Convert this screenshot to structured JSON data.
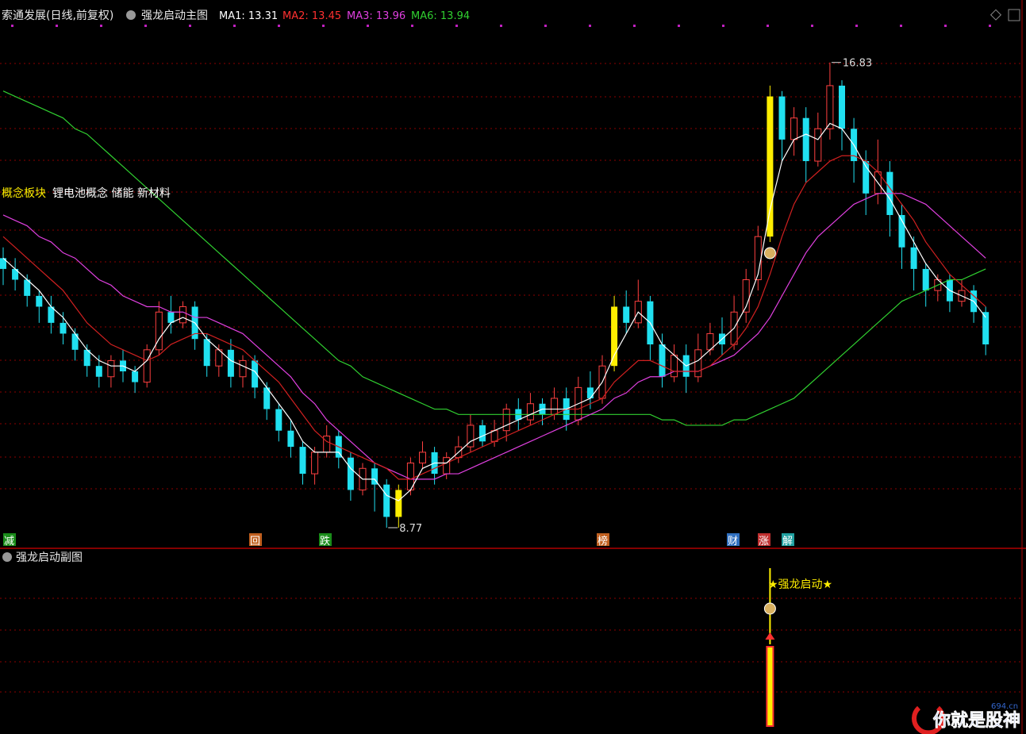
{
  "header": {
    "stock": "索通发展(日线,前复权)",
    "indicator": "强龙启动主图",
    "ma": [
      {
        "label": "MA1:",
        "value": "13.31",
        "color": "#ffffff"
      },
      {
        "label": "MA2:",
        "value": "13.45",
        "color": "#ff3030"
      },
      {
        "label": "MA3:",
        "value": "13.96",
        "color": "#e040e0"
      },
      {
        "label": "MA6:",
        "value": "13.94",
        "color": "#30d030"
      }
    ]
  },
  "concept": {
    "label": "概念板块",
    "items": "锂电池概念 储能 新材料"
  },
  "markers": {
    "high": "16.83",
    "low": "8.77"
  },
  "bottom_tags": [
    {
      "text": "减",
      "color": "#1a8c1a"
    },
    {
      "text": "回",
      "color": "#c06020"
    },
    {
      "text": "跌",
      "color": "#1a8c1a"
    },
    {
      "text": "榜",
      "color": "#c06020"
    },
    {
      "text": "财",
      "color": "#3070c0"
    },
    {
      "text": "涨",
      "color": "#c03030"
    },
    {
      "text": "解",
      "color": "#20a0a0"
    }
  ],
  "sub_panel": {
    "title": "强龙启动副图",
    "signal": "★强龙启动★"
  },
  "watermark": {
    "text": "你就是股神",
    "site": "694.cn"
  },
  "colors": {
    "up": "#ff4040",
    "down": "#20e0f0",
    "signal": "#ffee00",
    "grid": "#8b0000"
  },
  "chart_data": {
    "type": "candlestick",
    "title": "强龙启动主图",
    "ylim": [
      8.2,
      17.4
    ],
    "candles": [
      [
        13.2,
        13.0,
        13.4,
        12.7
      ],
      [
        13.0,
        12.8,
        13.2,
        12.6
      ],
      [
        12.8,
        12.5,
        12.9,
        12.3
      ],
      [
        12.5,
        12.3,
        12.6,
        12.0
      ],
      [
        12.3,
        12.0,
        12.5,
        11.8
      ],
      [
        12.0,
        11.8,
        12.2,
        11.6
      ],
      [
        11.8,
        11.5,
        11.9,
        11.3
      ],
      [
        11.5,
        11.2,
        11.6,
        11.0
      ],
      [
        11.2,
        11.0,
        11.4,
        10.8
      ],
      [
        11.0,
        11.3,
        11.4,
        10.8
      ],
      [
        11.3,
        11.1,
        11.5,
        10.9
      ],
      [
        11.1,
        10.9,
        11.2,
        10.7
      ],
      [
        10.9,
        11.5,
        11.6,
        10.8
      ],
      [
        11.5,
        12.2,
        12.4,
        11.4
      ],
      [
        12.2,
        12.0,
        12.5,
        11.8
      ],
      [
        12.0,
        12.3,
        12.4,
        11.9
      ],
      [
        12.3,
        11.7,
        12.4,
        11.5
      ],
      [
        11.7,
        11.2,
        11.8,
        11.0
      ],
      [
        11.2,
        11.5,
        11.6,
        11.0
      ],
      [
        11.5,
        11.0,
        11.7,
        10.8
      ],
      [
        11.0,
        11.3,
        11.4,
        10.8
      ],
      [
        11.3,
        10.8,
        11.4,
        10.6
      ],
      [
        10.8,
        10.4,
        10.9,
        10.2
      ],
      [
        10.4,
        10.0,
        10.5,
        9.8
      ],
      [
        10.0,
        9.7,
        10.2,
        9.5
      ],
      [
        9.7,
        9.2,
        9.8,
        9.0
      ],
      [
        9.2,
        9.6,
        9.7,
        9.0
      ],
      [
        9.6,
        9.9,
        10.1,
        9.5
      ],
      [
        9.9,
        9.5,
        10.0,
        9.3
      ],
      [
        9.5,
        8.9,
        9.6,
        8.7
      ],
      [
        8.9,
        9.3,
        9.4,
        8.8
      ],
      [
        9.3,
        9.0,
        9.4,
        8.5
      ],
      [
        9.0,
        8.4,
        9.1,
        8.2
      ],
      [
        8.4,
        8.9,
        9.0,
        8.2
      ],
      [
        8.9,
        9.4,
        9.5,
        8.8
      ],
      [
        9.4,
        9.6,
        9.8,
        9.3
      ],
      [
        9.6,
        9.2,
        9.7,
        9.0
      ],
      [
        9.2,
        9.5,
        9.6,
        9.1
      ],
      [
        9.5,
        9.7,
        9.9,
        9.4
      ],
      [
        9.7,
        10.1,
        10.3,
        9.6
      ],
      [
        10.1,
        9.8,
        10.2,
        9.7
      ],
      [
        9.8,
        10.0,
        10.2,
        9.7
      ],
      [
        10.0,
        10.4,
        10.5,
        9.8
      ],
      [
        10.4,
        10.2,
        10.6,
        10.0
      ],
      [
        10.2,
        10.5,
        10.7,
        10.1
      ],
      [
        10.5,
        10.3,
        10.6,
        10.1
      ],
      [
        10.3,
        10.6,
        10.8,
        10.2
      ],
      [
        10.6,
        10.2,
        10.8,
        10.0
      ],
      [
        10.2,
        10.8,
        11.0,
        10.1
      ],
      [
        10.8,
        10.6,
        11.1,
        10.4
      ],
      [
        10.6,
        11.2,
        11.4,
        10.5
      ],
      [
        11.2,
        12.3,
        12.5,
        11.1
      ],
      [
        12.3,
        12.0,
        12.6,
        11.8
      ],
      [
        12.0,
        12.4,
        12.8,
        11.9
      ],
      [
        12.4,
        11.6,
        12.5,
        11.3
      ],
      [
        11.6,
        11.0,
        11.8,
        10.8
      ],
      [
        11.0,
        11.4,
        11.6,
        10.9
      ],
      [
        11.4,
        11.0,
        11.6,
        10.7
      ],
      [
        11.0,
        11.5,
        11.8,
        10.9
      ],
      [
        11.5,
        11.8,
        12.0,
        11.4
      ],
      [
        11.8,
        11.6,
        12.1,
        11.4
      ],
      [
        11.6,
        12.2,
        12.5,
        11.5
      ],
      [
        12.2,
        12.8,
        13.0,
        12.0
      ],
      [
        12.8,
        13.6,
        13.8,
        12.6
      ],
      [
        13.6,
        16.2,
        16.4,
        13.5
      ],
      [
        16.2,
        15.4,
        16.3,
        15.0
      ],
      [
        15.4,
        15.8,
        16.0,
        15.1
      ],
      [
        15.8,
        15.0,
        16.0,
        14.6
      ],
      [
        15.0,
        15.6,
        15.9,
        14.9
      ],
      [
        15.6,
        16.4,
        16.83,
        15.4
      ],
      [
        16.4,
        15.6,
        16.5,
        15.2
      ],
      [
        15.6,
        15.0,
        15.8,
        14.6
      ],
      [
        15.0,
        14.4,
        15.2,
        14.0
      ],
      [
        14.4,
        14.8,
        15.4,
        14.2
      ],
      [
        14.8,
        14.0,
        15.0,
        13.6
      ],
      [
        14.0,
        13.4,
        14.2,
        13.0
      ],
      [
        13.4,
        13.0,
        13.6,
        12.6
      ],
      [
        13.0,
        12.6,
        13.1,
        12.3
      ],
      [
        12.6,
        12.8,
        12.9,
        12.4
      ],
      [
        12.8,
        12.4,
        12.9,
        12.2
      ],
      [
        12.4,
        12.6,
        12.8,
        12.3
      ],
      [
        12.6,
        12.2,
        12.7,
        12.0
      ],
      [
        12.2,
        11.6,
        12.3,
        11.4
      ]
    ],
    "ma1": [
      13.2,
      13.0,
      12.8,
      12.6,
      12.3,
      12.1,
      11.8,
      11.5,
      11.3,
      11.2,
      11.2,
      11.1,
      11.3,
      11.7,
      12.0,
      12.1,
      12.0,
      11.7,
      11.5,
      11.3,
      11.2,
      11.1,
      10.8,
      10.5,
      10.2,
      9.8,
      9.6,
      9.6,
      9.6,
      9.3,
      9.1,
      9.1,
      8.8,
      8.7,
      8.9,
      9.3,
      9.4,
      9.4,
      9.6,
      9.8,
      9.9,
      10.0,
      10.1,
      10.2,
      10.3,
      10.4,
      10.4,
      10.4,
      10.5,
      10.6,
      10.9,
      11.4,
      11.8,
      12.2,
      12.0,
      11.6,
      11.4,
      11.2,
      11.3,
      11.5,
      11.7,
      11.9,
      12.3,
      12.9,
      14.1,
      15.0,
      15.4,
      15.5,
      15.4,
      15.7,
      15.6,
      15.3,
      14.9,
      14.6,
      14.3,
      13.9,
      13.5,
      13.1,
      12.8,
      12.6,
      12.5,
      12.4,
      12.1
    ],
    "ma2": [
      13.6,
      13.4,
      13.2,
      13.0,
      12.8,
      12.6,
      12.3,
      12.0,
      11.8,
      11.6,
      11.5,
      11.4,
      11.3,
      11.4,
      11.6,
      11.7,
      11.8,
      11.8,
      11.7,
      11.6,
      11.5,
      11.3,
      11.1,
      10.9,
      10.6,
      10.3,
      10.0,
      9.8,
      9.7,
      9.6,
      9.5,
      9.4,
      9.3,
      9.1,
      9.1,
      9.2,
      9.3,
      9.4,
      9.5,
      9.6,
      9.7,
      9.8,
      9.9,
      10.0,
      10.1,
      10.2,
      10.3,
      10.4,
      10.4,
      10.5,
      10.6,
      10.9,
      11.1,
      11.3,
      11.3,
      11.2,
      11.1,
      11.1,
      11.1,
      11.2,
      11.4,
      11.6,
      11.9,
      12.3,
      12.9,
      13.6,
      14.2,
      14.6,
      14.8,
      15.0,
      15.1,
      15.1,
      15.0,
      14.8,
      14.5,
      14.2,
      13.9,
      13.5,
      13.2,
      12.9,
      12.7,
      12.5,
      12.3
    ],
    "ma3": [
      14.0,
      13.9,
      13.8,
      13.6,
      13.5,
      13.3,
      13.2,
      13.0,
      12.8,
      12.7,
      12.5,
      12.4,
      12.3,
      12.3,
      12.2,
      12.2,
      12.1,
      12.1,
      12.0,
      11.9,
      11.8,
      11.6,
      11.4,
      11.2,
      11.0,
      10.7,
      10.5,
      10.2,
      10.0,
      9.8,
      9.6,
      9.4,
      9.3,
      9.2,
      9.1,
      9.1,
      9.1,
      9.2,
      9.2,
      9.3,
      9.4,
      9.5,
      9.6,
      9.7,
      9.8,
      9.9,
      10.0,
      10.1,
      10.2,
      10.3,
      10.4,
      10.6,
      10.7,
      10.9,
      11.0,
      11.0,
      11.1,
      11.1,
      11.1,
      11.2,
      11.3,
      11.4,
      11.6,
      11.8,
      12.1,
      12.5,
      12.9,
      13.3,
      13.6,
      13.8,
      14.0,
      14.2,
      14.3,
      14.4,
      14.4,
      14.4,
      14.3,
      14.2,
      14.0,
      13.8,
      13.6,
      13.4,
      13.2
    ],
    "ma6": [
      16.3,
      16.2,
      16.1,
      16.0,
      15.9,
      15.8,
      15.6,
      15.5,
      15.3,
      15.1,
      14.9,
      14.7,
      14.5,
      14.3,
      14.1,
      13.9,
      13.7,
      13.5,
      13.3,
      13.1,
      12.9,
      12.7,
      12.5,
      12.3,
      12.1,
      11.9,
      11.7,
      11.5,
      11.3,
      11.2,
      11.0,
      10.9,
      10.8,
      10.7,
      10.6,
      10.5,
      10.4,
      10.4,
      10.3,
      10.3,
      10.3,
      10.3,
      10.3,
      10.3,
      10.3,
      10.3,
      10.3,
      10.3,
      10.3,
      10.3,
      10.3,
      10.3,
      10.3,
      10.3,
      10.3,
      10.2,
      10.2,
      10.1,
      10.1,
      10.1,
      10.1,
      10.2,
      10.2,
      10.3,
      10.4,
      10.5,
      10.6,
      10.8,
      11.0,
      11.2,
      11.4,
      11.6,
      11.8,
      12.0,
      12.2,
      12.4,
      12.5,
      12.6,
      12.7,
      12.8,
      12.8,
      12.9,
      13.0
    ],
    "signal_bars": [
      33,
      51,
      64
    ]
  }
}
